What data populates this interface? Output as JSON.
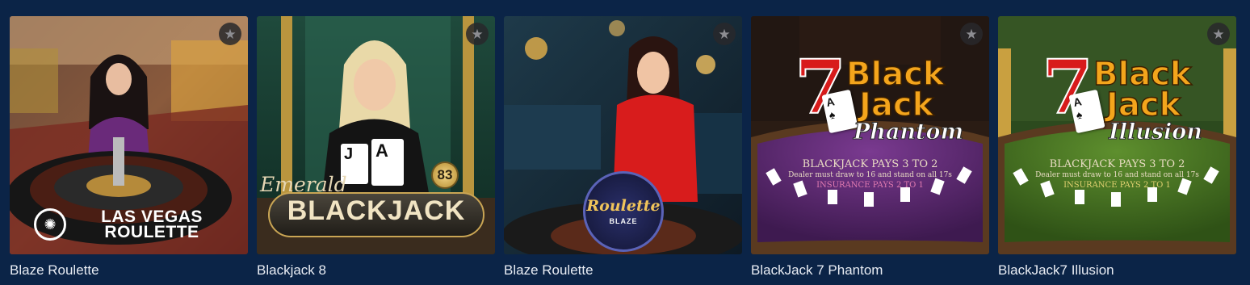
{
  "games": [
    {
      "title": "Blaze Roulette",
      "logo_text": "LAS VEGAS ROULETTE",
      "favorite_icon": "star-icon"
    },
    {
      "title": "Blackjack 8",
      "logo_script": "Emerald",
      "logo_text": "BLACKJACK",
      "badge": "83",
      "card_ranks": [
        "J",
        "A"
      ],
      "favorite_icon": "star-icon"
    },
    {
      "title": "Blaze Roulette",
      "logo_text": "Roulette",
      "logo_sub": "BLAZE",
      "favorite_icon": "star-icon"
    },
    {
      "title": "BlackJack 7 Phantom",
      "logo_number": "7",
      "logo_word_1": "Black",
      "logo_word_2": "Jack",
      "logo_script": "Phantom",
      "table_line_1": "BLACKJACK PAYS 3 TO 2",
      "table_line_2": "Dealer must draw to 16 and stand on all 17s",
      "table_line_3": "INSURANCE PAYS 2 TO 1",
      "favorite_icon": "star-icon"
    },
    {
      "title": "BlackJack7 Illusion",
      "logo_number": "7",
      "logo_word_1": "Black",
      "logo_word_2": "Jack",
      "logo_script": "Illusion",
      "table_line_1": "BLACKJACK PAYS 3 TO 2",
      "table_line_2": "Dealer must draw to 16 and stand on all 17s",
      "table_line_3": "INSURANCE PAYS 2 TO 1",
      "favorite_icon": "star-icon"
    }
  ],
  "colors": {
    "background": "#0b2447",
    "title_text": "#e9edf4",
    "phantom_felt": "#5a2a6e",
    "illusion_felt": "#3f6b22"
  }
}
